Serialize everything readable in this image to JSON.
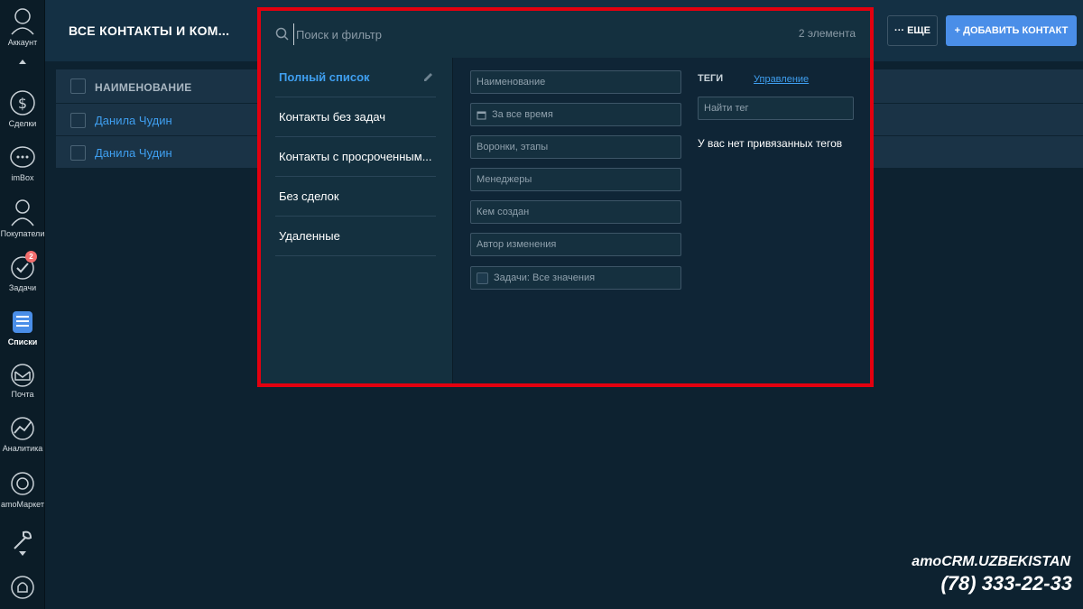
{
  "sidebar": {
    "items": [
      {
        "label": "Аккаунт",
        "icon": "avatar-icon"
      },
      {
        "label": "Сделки",
        "icon": "dollar-icon"
      },
      {
        "label": "imBox",
        "icon": "chat-icon"
      },
      {
        "label": "Покупатели",
        "icon": "customers-icon"
      },
      {
        "label": "Задачи",
        "icon": "check-icon",
        "badge": "2"
      },
      {
        "label": "Списки",
        "icon": "lists-icon"
      },
      {
        "label": "Почта",
        "icon": "mail-icon"
      },
      {
        "label": "Аналитика",
        "icon": "analytics-icon"
      },
      {
        "label": "amoМаркет",
        "icon": "market-icon"
      },
      {
        "label": "",
        "icon": "settings-icon"
      },
      {
        "label": "",
        "icon": "bell-icon"
      }
    ]
  },
  "header": {
    "title": "ВСЕ КОНТАКТЫ И КОМ...",
    "more_label": "··· ЕЩЕ",
    "add_label": "+ ДОБАВИТЬ КОНТАКТ"
  },
  "table": {
    "column_name": "НАИМЕНОВАНИЕ",
    "rows": [
      "Данила Чудин",
      "Данила Чудин"
    ]
  },
  "filter": {
    "search_placeholder": "Поиск и фильтр",
    "count": "2 элемента",
    "presets": [
      "Полный список",
      "Контакты без задач",
      "Контакты с просроченным...",
      "Без сделок",
      "Удаленные"
    ],
    "fields": {
      "name": "Наименование",
      "date": "За все время",
      "pipelines": "Воронки, этапы",
      "managers": "Менеджеры",
      "created_by": "Кем создан",
      "modified_by": "Автор изменения",
      "tasks": "Задачи: Все значения"
    },
    "tags": {
      "title": "ТЕГИ",
      "manage": "Управление",
      "placeholder": "Найти тег",
      "empty": "У вас нет привязанных тегов"
    }
  },
  "watermark": {
    "brand": "amoCRM.UZBEKISTAN",
    "phone": "(78) 333-22-33"
  },
  "colors": {
    "accent": "#4a8ee8",
    "link": "#3f9ff0",
    "highlight_border": "#e3000f",
    "badge": "#f26d6d"
  }
}
